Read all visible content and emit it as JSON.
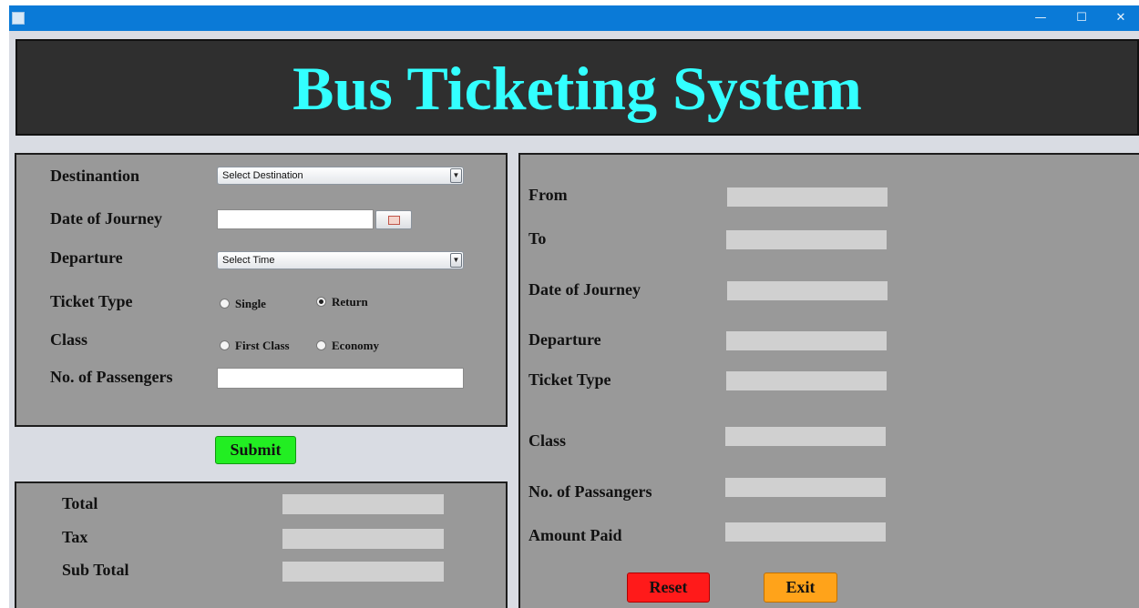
{
  "window": {
    "minimize_glyph": "—",
    "maximize_glyph": "☐",
    "close_glyph": "✕"
  },
  "header": {
    "title": "Bus Ticketing System"
  },
  "form": {
    "destination_label": "Destinantion",
    "destination_value": "Select Destination",
    "date_label": "Date of Journey",
    "date_value": "",
    "departure_label": "Departure",
    "departure_value": "Select Time",
    "ticket_type_label": "Ticket Type",
    "ticket_options": [
      {
        "label": "Single",
        "selected": false
      },
      {
        "label": "Return",
        "selected": true
      }
    ],
    "class_label": "Class",
    "class_options": [
      {
        "label": "First Class",
        "selected": false
      },
      {
        "label": "Economy",
        "selected": false
      }
    ],
    "passengers_label": "No. of Passengers",
    "passengers_value": ""
  },
  "submit_label": "Submit",
  "totals": {
    "total_label": "Total",
    "tax_label": "Tax",
    "subtotal_label": "Sub Total"
  },
  "summary": {
    "from_label": "From",
    "to_label": "To",
    "date_label": "Date of Journey",
    "departure_label": "Departure",
    "ticket_type_label": "Ticket Type",
    "class_label": "Class",
    "passengers_label": "No. of Passangers",
    "amount_label": "Amount Paid"
  },
  "buttons": {
    "reset_label": "Reset",
    "exit_label": "Exit"
  },
  "colors": {
    "title_bar": "#0a7ad7",
    "banner_bg": "#2f2f2f",
    "title_text": "#33ffff",
    "panel_bg": "#999999",
    "submit_bg": "#22ee22",
    "reset_bg": "#ff1a1a",
    "exit_bg": "#ffa31a"
  },
  "icons": {
    "app": "java-cup-icon",
    "calendar": "calendar-icon"
  }
}
